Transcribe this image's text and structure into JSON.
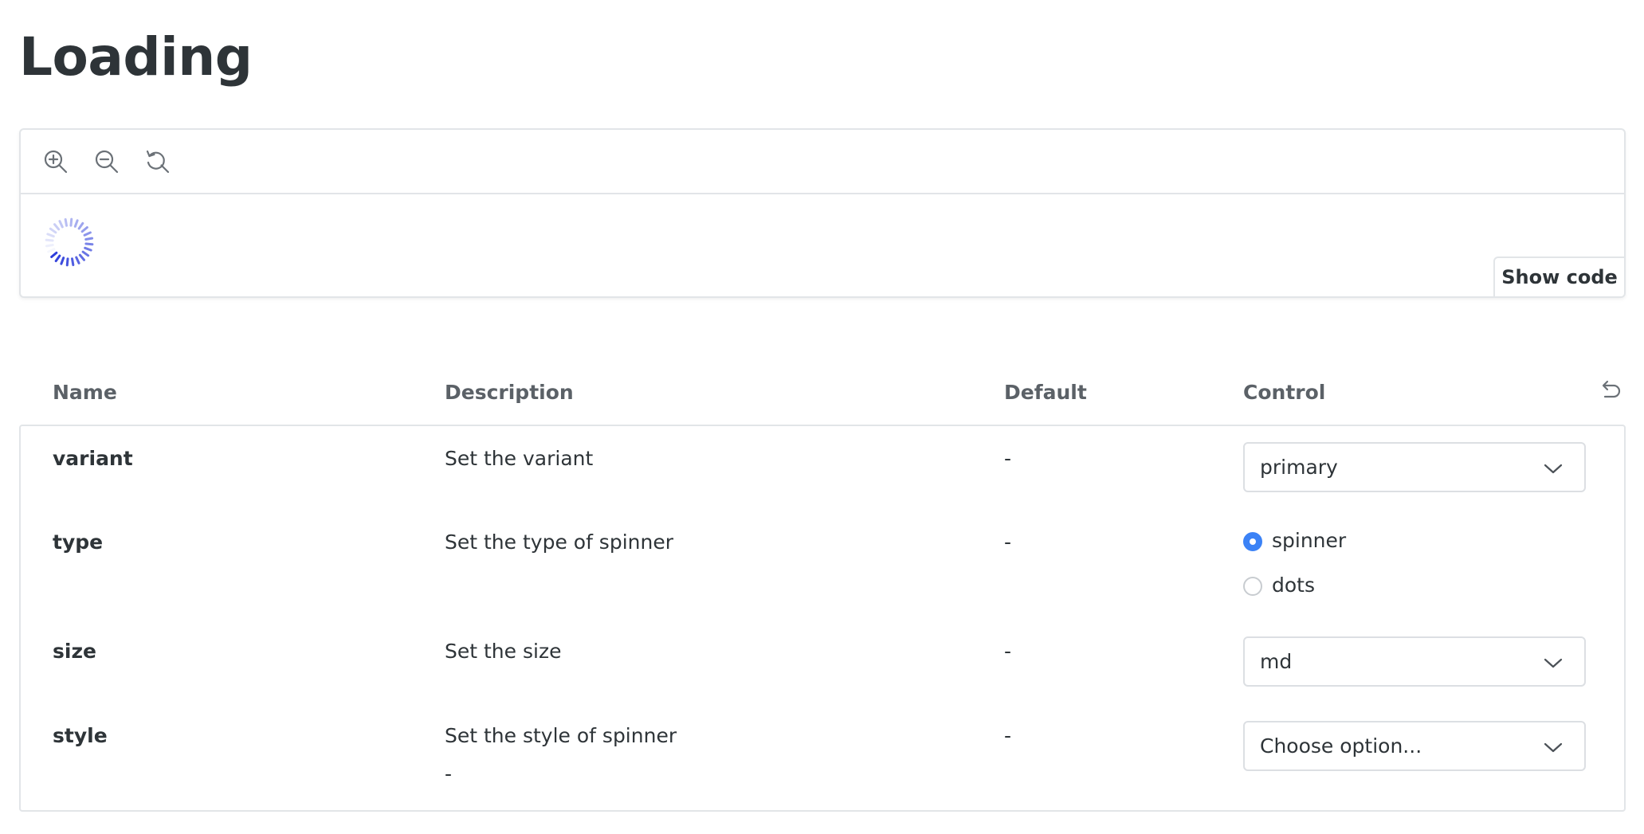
{
  "page": {
    "title": "Loading"
  },
  "preview": {
    "toolbar": {
      "zoom_in_icon": "zoom-in-icon",
      "zoom_out_icon": "zoom-out-icon",
      "reset_zoom_icon": "reset-zoom-icon"
    },
    "spinner_icon": "spinner-icon",
    "spinner_color": "#2d3ddb",
    "show_code_label": "Show code"
  },
  "args_table": {
    "headers": {
      "name": "Name",
      "description": "Description",
      "default": "Default",
      "control": "Control"
    },
    "reset_icon": "undo-icon",
    "rows": [
      {
        "name": "variant",
        "description": "Set the variant",
        "default": "-",
        "control": {
          "type": "select",
          "value": "primary"
        }
      },
      {
        "name": "type",
        "description": "Set the type of spinner",
        "default": "-",
        "control": {
          "type": "radio",
          "options": [
            {
              "label": "spinner",
              "checked": true
            },
            {
              "label": "dots",
              "checked": false
            }
          ]
        }
      },
      {
        "name": "size",
        "description": "Set the size",
        "default": "-",
        "control": {
          "type": "select",
          "value": "md"
        }
      },
      {
        "name": "style",
        "description": "Set the style of spinner",
        "description_detail": "-",
        "default": "-",
        "control": {
          "type": "select",
          "value": "Choose option..."
        }
      }
    ]
  },
  "colors": {
    "text": "#2e3438",
    "header_text": "#5b6167",
    "border": "#e2e5e8",
    "radio_checked": "#3b82f6"
  }
}
